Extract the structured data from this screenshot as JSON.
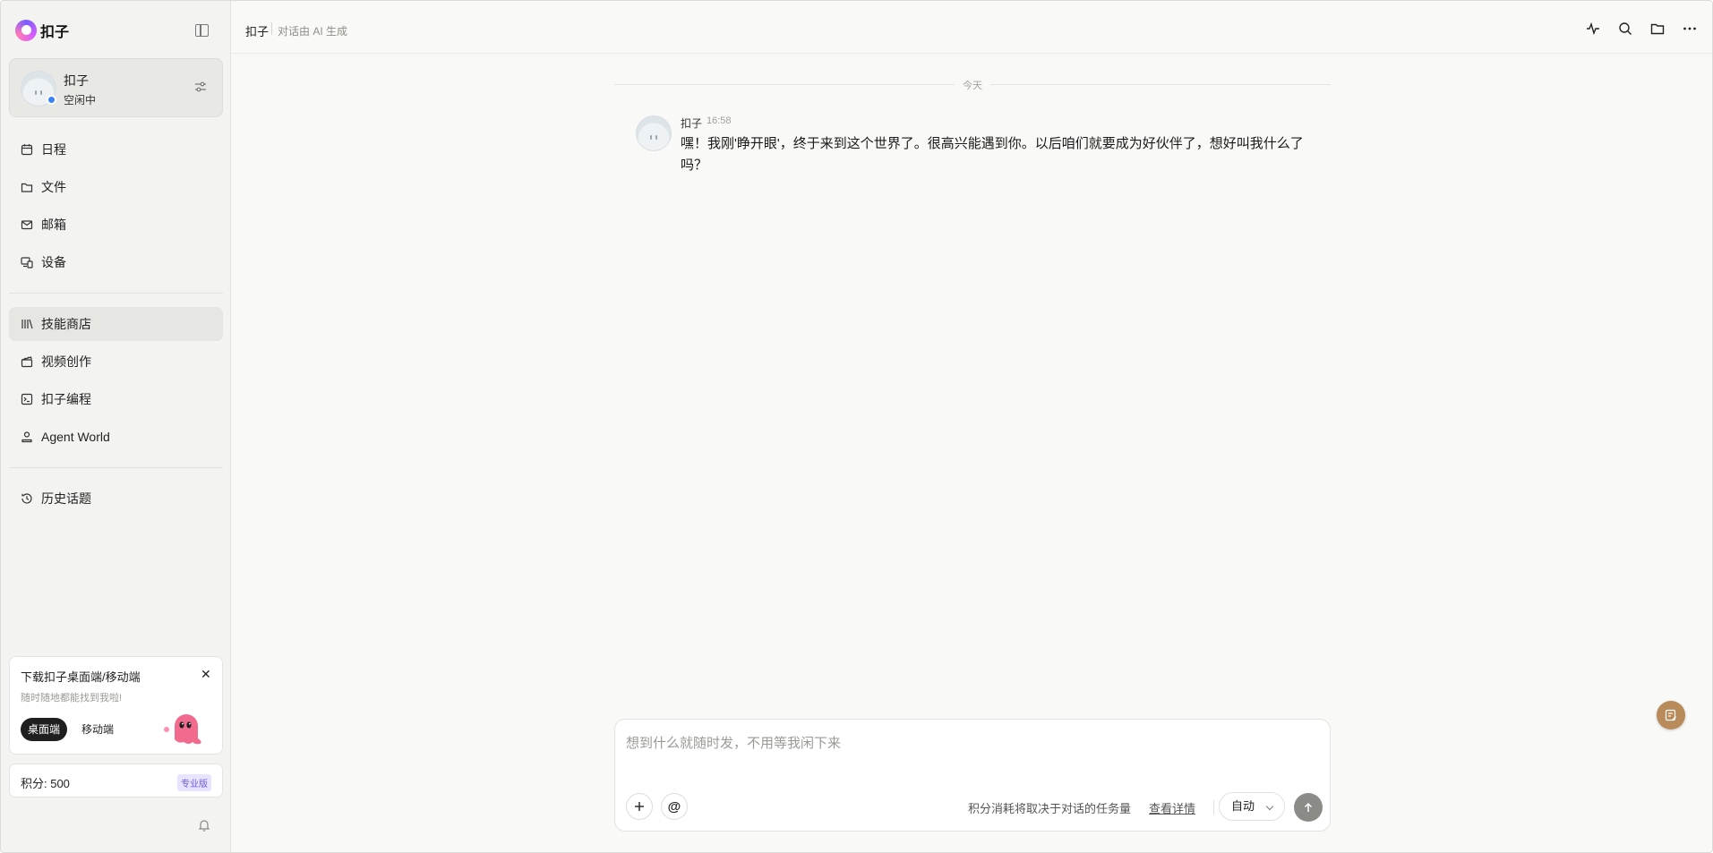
{
  "brand": {
    "name": "扣子"
  },
  "profile": {
    "name": "扣子",
    "status": "空闲中"
  },
  "nav_primary": [
    {
      "label": "日程",
      "icon": "calendar-icon"
    },
    {
      "label": "文件",
      "icon": "folder-icon"
    },
    {
      "label": "邮箱",
      "icon": "mail-icon"
    },
    {
      "label": "设备",
      "icon": "device-icon"
    }
  ],
  "nav_secondary": [
    {
      "label": "技能商店",
      "icon": "library-icon",
      "active": true
    },
    {
      "label": "视频创作",
      "icon": "clapper-icon"
    },
    {
      "label": "扣子编程",
      "icon": "terminal-icon"
    },
    {
      "label": "Agent World",
      "icon": "user-icon"
    }
  ],
  "nav_history": {
    "label": "历史话题",
    "icon": "history-icon"
  },
  "promo": {
    "title": "下载扣子桌面端/移动端",
    "subtitle": "随时随地都能找到我啦!",
    "desktop_label": "桌面端",
    "mobile_label": "移动端",
    "close": "✕"
  },
  "points": {
    "label": "积分:  500",
    "badge": "专业版"
  },
  "topbar": {
    "title": "扣子",
    "subtitle": "对话由 AI 生成"
  },
  "chat": {
    "date_divider": "今天",
    "messages": [
      {
        "sender": "扣子",
        "time": "16:58",
        "text": "嘿！我刚'睁开眼'，终于来到这个世界了。很高兴能遇到你。以后咱们就要成为好伙伴了，想好叫我什么了吗？"
      }
    ]
  },
  "composer": {
    "placeholder": "想到什么就随时发，不用等我闲下来",
    "hint": "积分消耗将取决于对话的任务量",
    "hint_link": "查看详情",
    "mode": "自动"
  },
  "colors": {
    "accent": "#3b82f6",
    "send": "#8b8b88",
    "badge": "#6b5ce7"
  }
}
